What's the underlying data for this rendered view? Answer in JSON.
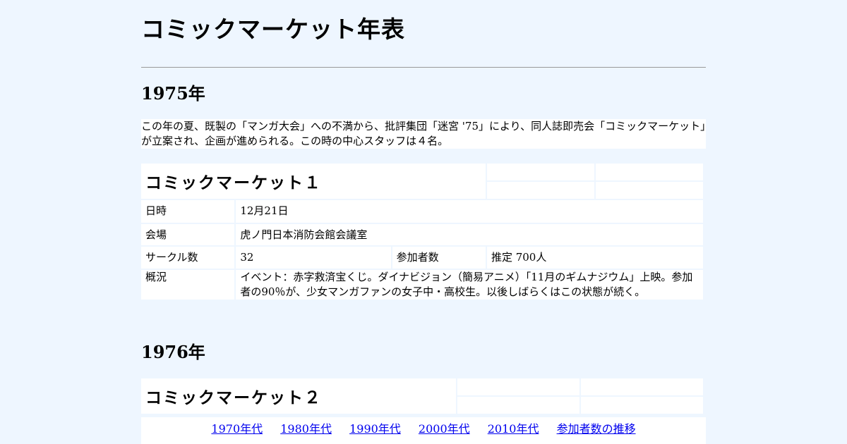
{
  "page": {
    "title": "コミックマーケット年表"
  },
  "sections": [
    {
      "year": "1975年",
      "intro": "この年の夏、既製の「マンガ大会」への不満から、批評集団「迷宮 '75」により、同人誌即売会「コミックマーケット」が立案され、企画が進められる。この時の中心スタッフは４名。",
      "event": {
        "title": "コミックマーケット１",
        "date_label": "日時",
        "date": "12月21日",
        "venue_label": "会場",
        "venue": "虎ノ門日本消防会館会議室",
        "circles_label": "サークル数",
        "circles": "32",
        "attendees_label": "参加者数",
        "attendees": "推定 700人",
        "summary_label": "概況",
        "summary": "イベント：赤字救済宝くじ。ダイナビジョン（簡易アニメ）「11月のギムナジウム」上映。参加者の90％が、少女マンガファンの女子中・高校生。以後しばらくはこの状態が続く。"
      }
    },
    {
      "year": "1976年",
      "event": {
        "title": "コミックマーケット２"
      }
    }
  ],
  "nav": {
    "items": [
      "1970年代",
      "1980年代",
      "1990年代",
      "2000年代",
      "2010年代",
      "参加者数の推移"
    ]
  }
}
